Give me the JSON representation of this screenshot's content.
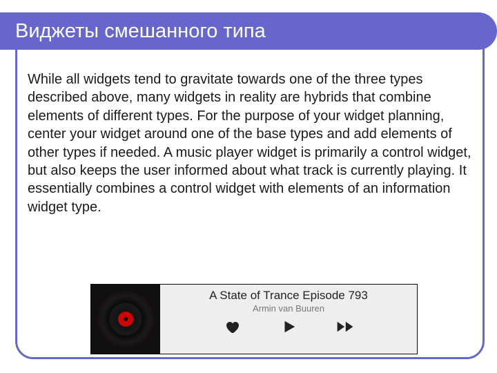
{
  "title": "Виджеты смешанного типа",
  "body_text": "While all widgets tend to gravitate towards one of the three types described above, many widgets in reality are hybrids that combine elements of different types. For the purpose of your widget planning, center your widget around one of the base types and add elements of other types if needed. A music player widget is primarily a control widget, but also keeps the user informed about what track is currently playing. It essentially combines a control widget with elements of an information widget type.",
  "player": {
    "track_title": "A State of Trance Episode 793",
    "artist": "Armin van Buuren"
  }
}
